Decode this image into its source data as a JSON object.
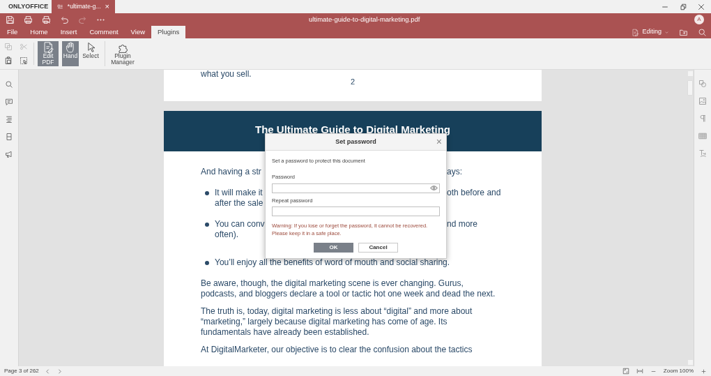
{
  "window": {
    "brand": "ONLYOFFICE",
    "tab_title": "*ultimate-g...",
    "tab_close": "×",
    "title": "ultimate-guide-to-digital-marketing.pdf",
    "avatar": "A"
  },
  "quick_actions": [
    {
      "kind": "save",
      "disabled": false
    },
    {
      "kind": "print",
      "disabled": false
    },
    {
      "kind": "quick-print",
      "disabled": false
    },
    {
      "kind": "undo",
      "disabled": false
    },
    {
      "kind": "redo",
      "disabled": true
    },
    {
      "kind": "more",
      "disabled": false
    }
  ],
  "menu_tabs": [
    {
      "label": "File",
      "selected": false
    },
    {
      "label": "Home",
      "selected": false
    },
    {
      "label": "Insert",
      "selected": false
    },
    {
      "label": "Comment",
      "selected": false
    },
    {
      "label": "View",
      "selected": false
    },
    {
      "label": "Plugins",
      "selected": true
    }
  ],
  "mode": {
    "label": "Editing"
  },
  "small_tools": [
    {
      "kind": "copy",
      "disabled": true
    },
    {
      "kind": "cut",
      "disabled": true
    },
    {
      "kind": "paste",
      "disabled": false
    },
    {
      "kind": "select-all",
      "disabled": false
    }
  ],
  "tools": [
    {
      "kind": "edit",
      "label": "Edit PDF",
      "pressed": true
    },
    {
      "kind": "hand",
      "label": "Hand",
      "pressed": true
    },
    {
      "kind": "select",
      "label": "Select",
      "pressed": false
    },
    {
      "kind": "plugin",
      "label": "Plugin Manager",
      "pressed": false
    }
  ],
  "left_sidebar": [
    {
      "kind": "search"
    },
    {
      "kind": "comment"
    },
    {
      "kind": "headings"
    },
    {
      "kind": "thumbnails"
    },
    {
      "kind": "feedback"
    }
  ],
  "right_sidebar": [
    {
      "kind": "shape"
    },
    {
      "kind": "image"
    },
    {
      "kind": "paragraph"
    },
    {
      "kind": "table"
    },
    {
      "kind": "textart"
    }
  ],
  "document": {
    "previous_page": {
      "text": "what you sell.",
      "page_number": "2"
    },
    "heading": "The Ultimate Guide to Digital Marketing",
    "blocks": [
      {
        "kind": "split",
        "left": "And having a str",
        "right": "ays:"
      },
      {
        "kind": "bullet",
        "lines": [
          {
            "left": "It will make it",
            "right": "oth before and"
          },
          {
            "left": "after the sale"
          }
        ]
      },
      {
        "kind": "bullet",
        "lines": [
          {
            "left": "You can conv",
            "right": "nd more"
          },
          {
            "left": "often)."
          }
        ]
      },
      {
        "kind": "bullet",
        "lines": [
          {
            "left": "You’ll enjoy all the benefits of word of mouth and social sharing."
          }
        ]
      },
      {
        "kind": "paragraph",
        "text": "Be aware, though, the digital marketing scene is ever changing. Gurus, podcasts, and bloggers declare a tool or tactic hot one week and dead the next."
      },
      {
        "kind": "paragraph",
        "text": "The truth is, today, digital marketing is less about “digital” and more about “marketing,” largely because digital marketing has come of age. Its fundamentals have already been established."
      },
      {
        "kind": "paragraph",
        "text": "At DigitalMarketer, our objective is to clear the confusion about the tactics"
      }
    ]
  },
  "dialog": {
    "title": "Set password",
    "close": "×",
    "description": "Set a password to protect this document",
    "password_label": "Password",
    "repeat_label": "Repeat password",
    "warning": "Warning: If you lose or forget the password, it cannot be recovered.\nPlease keep it in a safe place.",
    "ok": "OK",
    "cancel": "Cancel"
  },
  "status_bar": {
    "page": "Page 3 of 262",
    "zoom": "Zoom 100%"
  }
}
